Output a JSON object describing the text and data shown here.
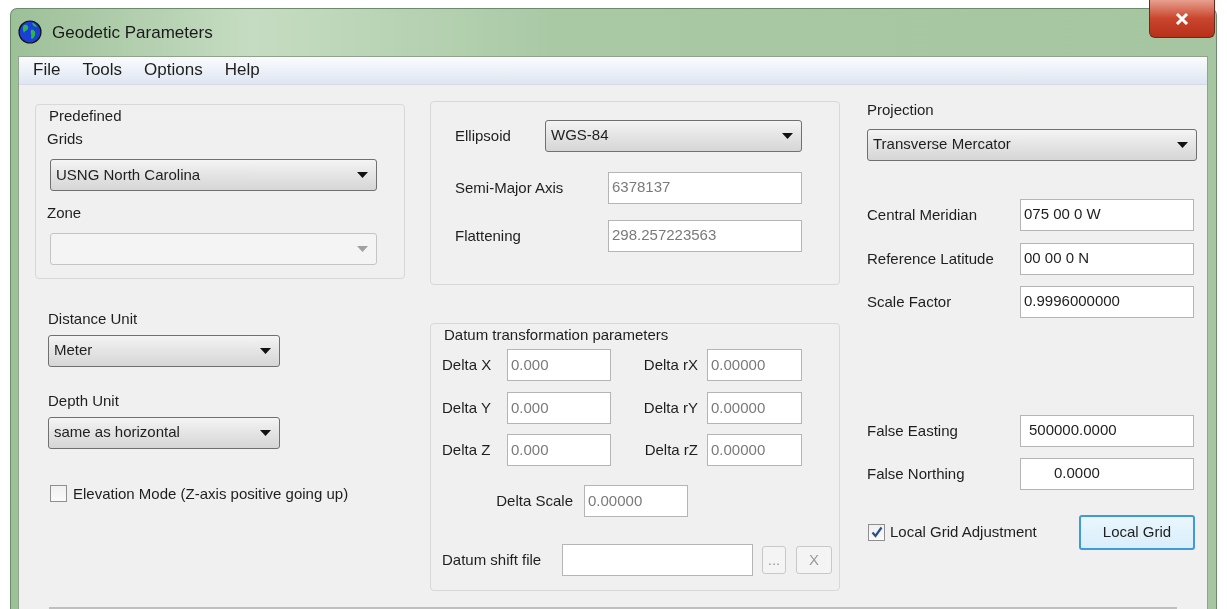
{
  "window": {
    "title": "Geodetic Parameters"
  },
  "menu": [
    "File",
    "Tools",
    "Options",
    "Help"
  ],
  "predefined": {
    "legend": "Predefined",
    "grids": {
      "label": "Grids",
      "value": "USNG North Carolina",
      "disabled": false
    },
    "zone": {
      "label": "Zone",
      "disabled": true
    }
  },
  "distance_unit": {
    "label": "Distance Unit",
    "value": "Meter"
  },
  "depth_unit": {
    "label": "Depth Unit",
    "value": "same as horizontal"
  },
  "elevation_mode": {
    "label": "Elevation Mode (Z-axis positive going up)",
    "checked": false
  },
  "ellipsoid": {
    "label": "Ellipsoid",
    "value": "WGS-84",
    "fields": [
      {
        "label": "Semi-Major Axis",
        "value": "6378137",
        "disabled": true
      },
      {
        "label": "Flattening",
        "value": "298.257223563",
        "disabled": true
      }
    ]
  },
  "datum": {
    "legend": "Datum transformation parameters",
    "fields": [
      {
        "label": "Delta X",
        "value": "0.000",
        "disabled": true
      },
      {
        "label": "Delta rX",
        "value": "0.00000",
        "disabled": true
      },
      {
        "label": "Delta Y",
        "value": "0.000",
        "disabled": true
      },
      {
        "label": "Delta rY",
        "value": "0.00000",
        "disabled": true
      },
      {
        "label": "Delta Z",
        "value": "0.000",
        "disabled": true
      },
      {
        "label": "Delta rZ",
        "value": "0.00000",
        "disabled": true
      }
    ],
    "delta_scale": {
      "label": "Delta Scale",
      "value": "0.00000",
      "disabled": true
    },
    "shift_file": {
      "label": "Datum shift file",
      "buttons": [
        {
          "label": "...",
          "disabled": true
        },
        {
          "label": "X",
          "disabled": true
        }
      ]
    }
  },
  "projection": {
    "label": "Projection",
    "value": "Transverse Mercator",
    "params": [
      {
        "label": "Central Meridian",
        "value": "075 00 0 W",
        "disabled": false
      },
      {
        "label": "Reference Latitude",
        "value": "00 00 0 N",
        "disabled": false
      },
      {
        "label": "Scale Factor",
        "value": "0.9996000000",
        "disabled": false
      }
    ],
    "false_params": [
      {
        "label": "False Easting",
        "value": "500000.0000",
        "disabled": false
      },
      {
        "label": "False Northing",
        "value": "0.0000",
        "disabled": false
      }
    ],
    "local_grid": {
      "label": "Local Grid Adjustment",
      "checked": true
    },
    "local_grid_button": {
      "label": "Local Grid",
      "default": true
    }
  }
}
